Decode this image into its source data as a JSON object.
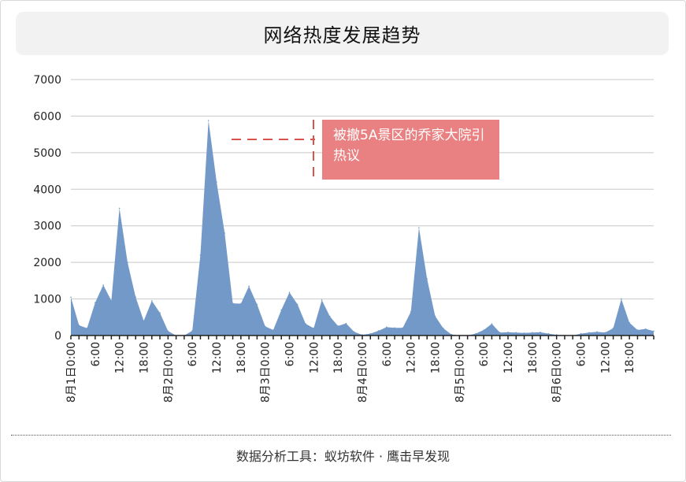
{
  "title": "网络热度发展趋势",
  "footer": "数据分析工具：蚁坊软件 · 鹰击早发现",
  "annotation": {
    "text": "被撤5A景区的乔家大院引热议"
  },
  "colors": {
    "area_fill": "#7399c9",
    "annotation_bg": "#e98081",
    "annotation_line": "#d9534f",
    "grid": "#c8c8c8"
  },
  "chart_data": {
    "type": "area",
    "title": "网络热度发展趋势",
    "xlabel": "",
    "ylabel": "",
    "ylim": [
      0,
      7000
    ],
    "yticks": [
      0,
      1000,
      2000,
      3000,
      4000,
      5000,
      6000,
      7000
    ],
    "x_tick_labels": [
      "8月1日0:00",
      "6:00",
      "12:00",
      "18:00",
      "8月2日0:00",
      "6:00",
      "12:00",
      "18:00",
      "8月3日0:00",
      "6:00",
      "12:00",
      "18:00",
      "8月4日0:00",
      "6:00",
      "12:00",
      "18:00",
      "8月5日0:00",
      "6:00",
      "12:00",
      "18:00",
      "8月6日0:00",
      "6:00",
      "12:00",
      "18:00"
    ],
    "x_hours_per_point": 2,
    "grid": true,
    "legend": "none",
    "series": [
      {
        "values": [
          1050,
          280,
          200,
          900,
          1380,
          950,
          3480,
          2000,
          1050,
          400,
          950,
          620,
          120,
          0,
          0,
          130,
          2200,
          5880,
          4200,
          2800,
          880,
          870,
          1350,
          850,
          250,
          150,
          700,
          1180,
          850,
          320,
          200,
          970,
          520,
          260,
          330,
          100,
          20,
          50,
          130,
          230,
          210,
          210,
          650,
          2950,
          1550,
          530,
          200,
          30,
          0,
          0,
          50,
          150,
          320,
          80,
          90,
          80,
          70,
          80,
          90,
          50,
          20,
          0,
          0,
          50,
          80,
          100,
          80,
          200,
          1000,
          350,
          150,
          180,
          120
        ]
      }
    ]
  }
}
